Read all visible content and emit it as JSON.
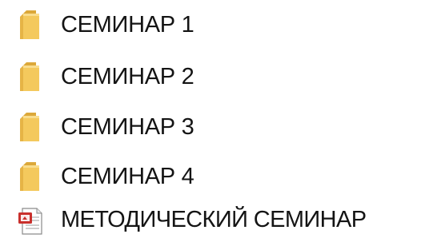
{
  "files": [
    {
      "name": "СЕМИНАР 1",
      "type": "folder",
      "icon": "folder-icon"
    },
    {
      "name": "СЕМИНАР 2",
      "type": "folder",
      "icon": "folder-icon"
    },
    {
      "name": "СЕМИНАР 3",
      "type": "folder",
      "icon": "folder-icon"
    },
    {
      "name": "СЕМИНАР 4",
      "type": "folder",
      "icon": "folder-icon"
    },
    {
      "name": "МЕТОДИЧЕСКИЙ СЕМИНАР",
      "type": "presentation",
      "icon": "powerpoint-file-icon"
    }
  ],
  "colors": {
    "folder_body": "#f4c95d",
    "folder_tab": "#dca83a",
    "ppt_red": "#c9302c"
  }
}
